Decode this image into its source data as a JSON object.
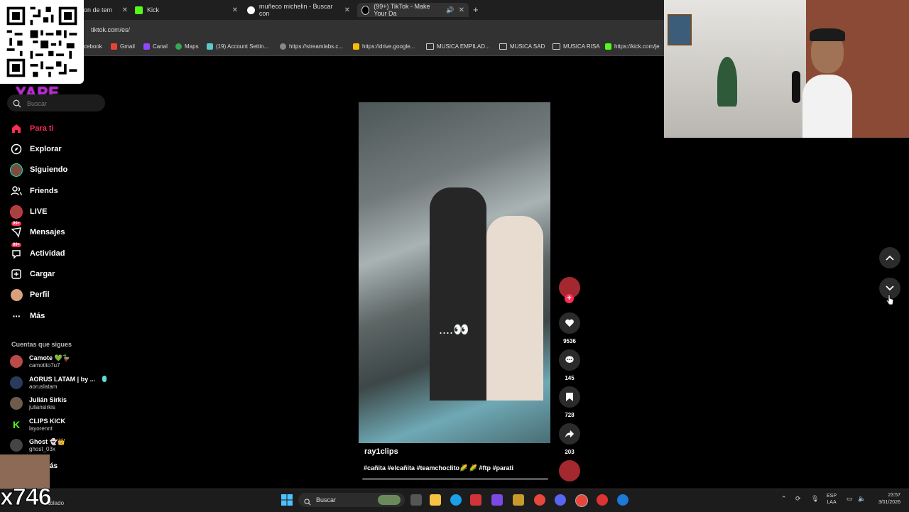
{
  "browser": {
    "tabs": [
      {
        "title": "on de tem",
        "active": false
      },
      {
        "title": "Kick",
        "active": false
      },
      {
        "title": "muñeco michelin - Buscar con",
        "active": false
      },
      {
        "title": "(99+) TikTok - Make Your Da",
        "active": true
      }
    ],
    "new_tab": "+",
    "url": "tiktok.com/es/",
    "bookmarks": [
      "cebook",
      "Gmail",
      "Canal",
      "Maps",
      "(19) Account Settin...",
      "https://streamlabs.c...",
      "https://drive.google...",
      "MUSICA EMPILAD...",
      "MUSICA SAD",
      "MUSICA RISA",
      "https://kick.com/je"
    ]
  },
  "overlay": {
    "yape_label": "YAPE",
    "counter": "x746",
    "weather": "ublado"
  },
  "tiktok": {
    "search_placeholder": "Buscar",
    "nav": [
      {
        "label": "Para ti",
        "icon": "home-icon",
        "active": true
      },
      {
        "label": "Explorar",
        "icon": "compass-icon"
      },
      {
        "label": "Siguiendo",
        "icon": "following-avatar-icon"
      },
      {
        "label": "Friends",
        "icon": "friends-icon"
      },
      {
        "label": "LIVE",
        "icon": "live-icon"
      },
      {
        "label": "Mensajes",
        "icon": "messages-icon",
        "badge": "99+"
      },
      {
        "label": "Actividad",
        "icon": "activity-icon",
        "badge": "99+"
      },
      {
        "label": "Cargar",
        "icon": "upload-icon"
      },
      {
        "label": "Perfil",
        "icon": "profile-icon"
      },
      {
        "label": "Más",
        "icon": "more-icon"
      }
    ],
    "following_title": "Cuentas que sigues",
    "following": [
      {
        "name": "Camote 💚🦆",
        "user": "camotito7u7"
      },
      {
        "name": "AORUS LATAM | by ...",
        "user": "aoruslatam"
      },
      {
        "name": "Julián Sirkis",
        "user": "juliansirkis"
      },
      {
        "name": "CLIPS KICK",
        "user": "layorennt"
      },
      {
        "name": "Ghost 👻👑",
        "user": "ghost_03x"
      }
    ],
    "see_more": "ás",
    "video": {
      "author": "ray1clips",
      "tags": "#cañita #elcañita #teamchoclito🌽 🌽 #ftp #parati",
      "overlay_text": "....👀",
      "likes": "9536",
      "comments": "145",
      "saves": "728",
      "shares": "203"
    }
  },
  "taskbar": {
    "search_label": "Buscar",
    "lang": "ESP",
    "lang2": "LAA",
    "time": "23:57",
    "date": "3/01/2026"
  },
  "colors": {
    "accent": "#fe2c55",
    "yape": "#b62ad9",
    "background": "#000000"
  }
}
